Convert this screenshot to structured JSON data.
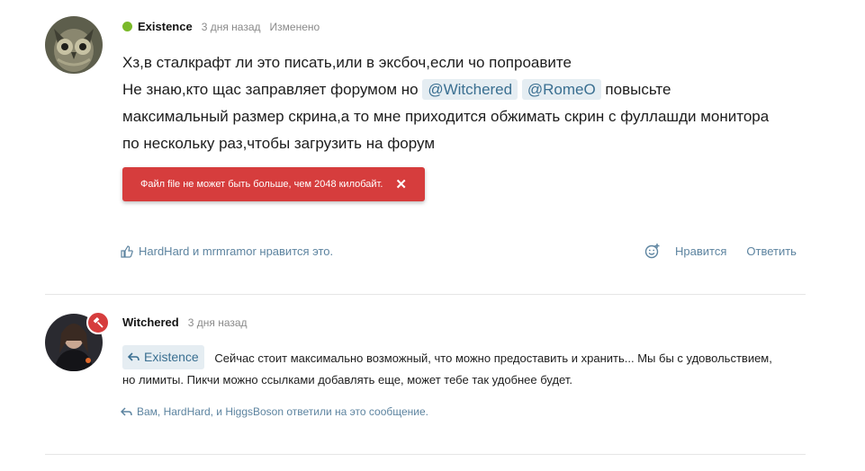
{
  "post1": {
    "author": "Existence",
    "time": "3 дня назад",
    "edited": "Изменено",
    "line1": "Хз,в сталкрафт ли это писать,или в эксбоч,если чо попроавите",
    "line2_pre": "Не знаю,кто щас заправляет форумом но",
    "mention1": "@Witchered",
    "mention2": "@RomeO",
    "line2_post": "повысьте",
    "line3": "максимальный размер скрина,а то мне приходится обжимать скрин с фуллашди монитора",
    "line4": "по нескольку раз,чтобы загрузить на форум",
    "error_text": "Файл file не может быть больше, чем 2048 килобайт.",
    "likes_text": "HardHard и mrmramor нравится это.",
    "like_action": "Нравится",
    "reply_action": "Ответить"
  },
  "post2": {
    "author": "Witchered",
    "time": "3 дня назад",
    "quote_label": "Existence",
    "reply_line1": "Сейчас стоит максимально возможный, что можно предоставить и хранить... Мы бы с удовольствием,",
    "reply_line2": "но лимиты. Пикчи можно ссылками добавлять еще, может тебе так удобнее будет.",
    "replied_text": "Вам, HardHard, и HiggsBoson ответили на это сообщение."
  },
  "colors": {
    "online": "#7ab929",
    "error": "#d63d3d",
    "link": "#5d84a0",
    "mention_bg": "#e5edf2"
  }
}
